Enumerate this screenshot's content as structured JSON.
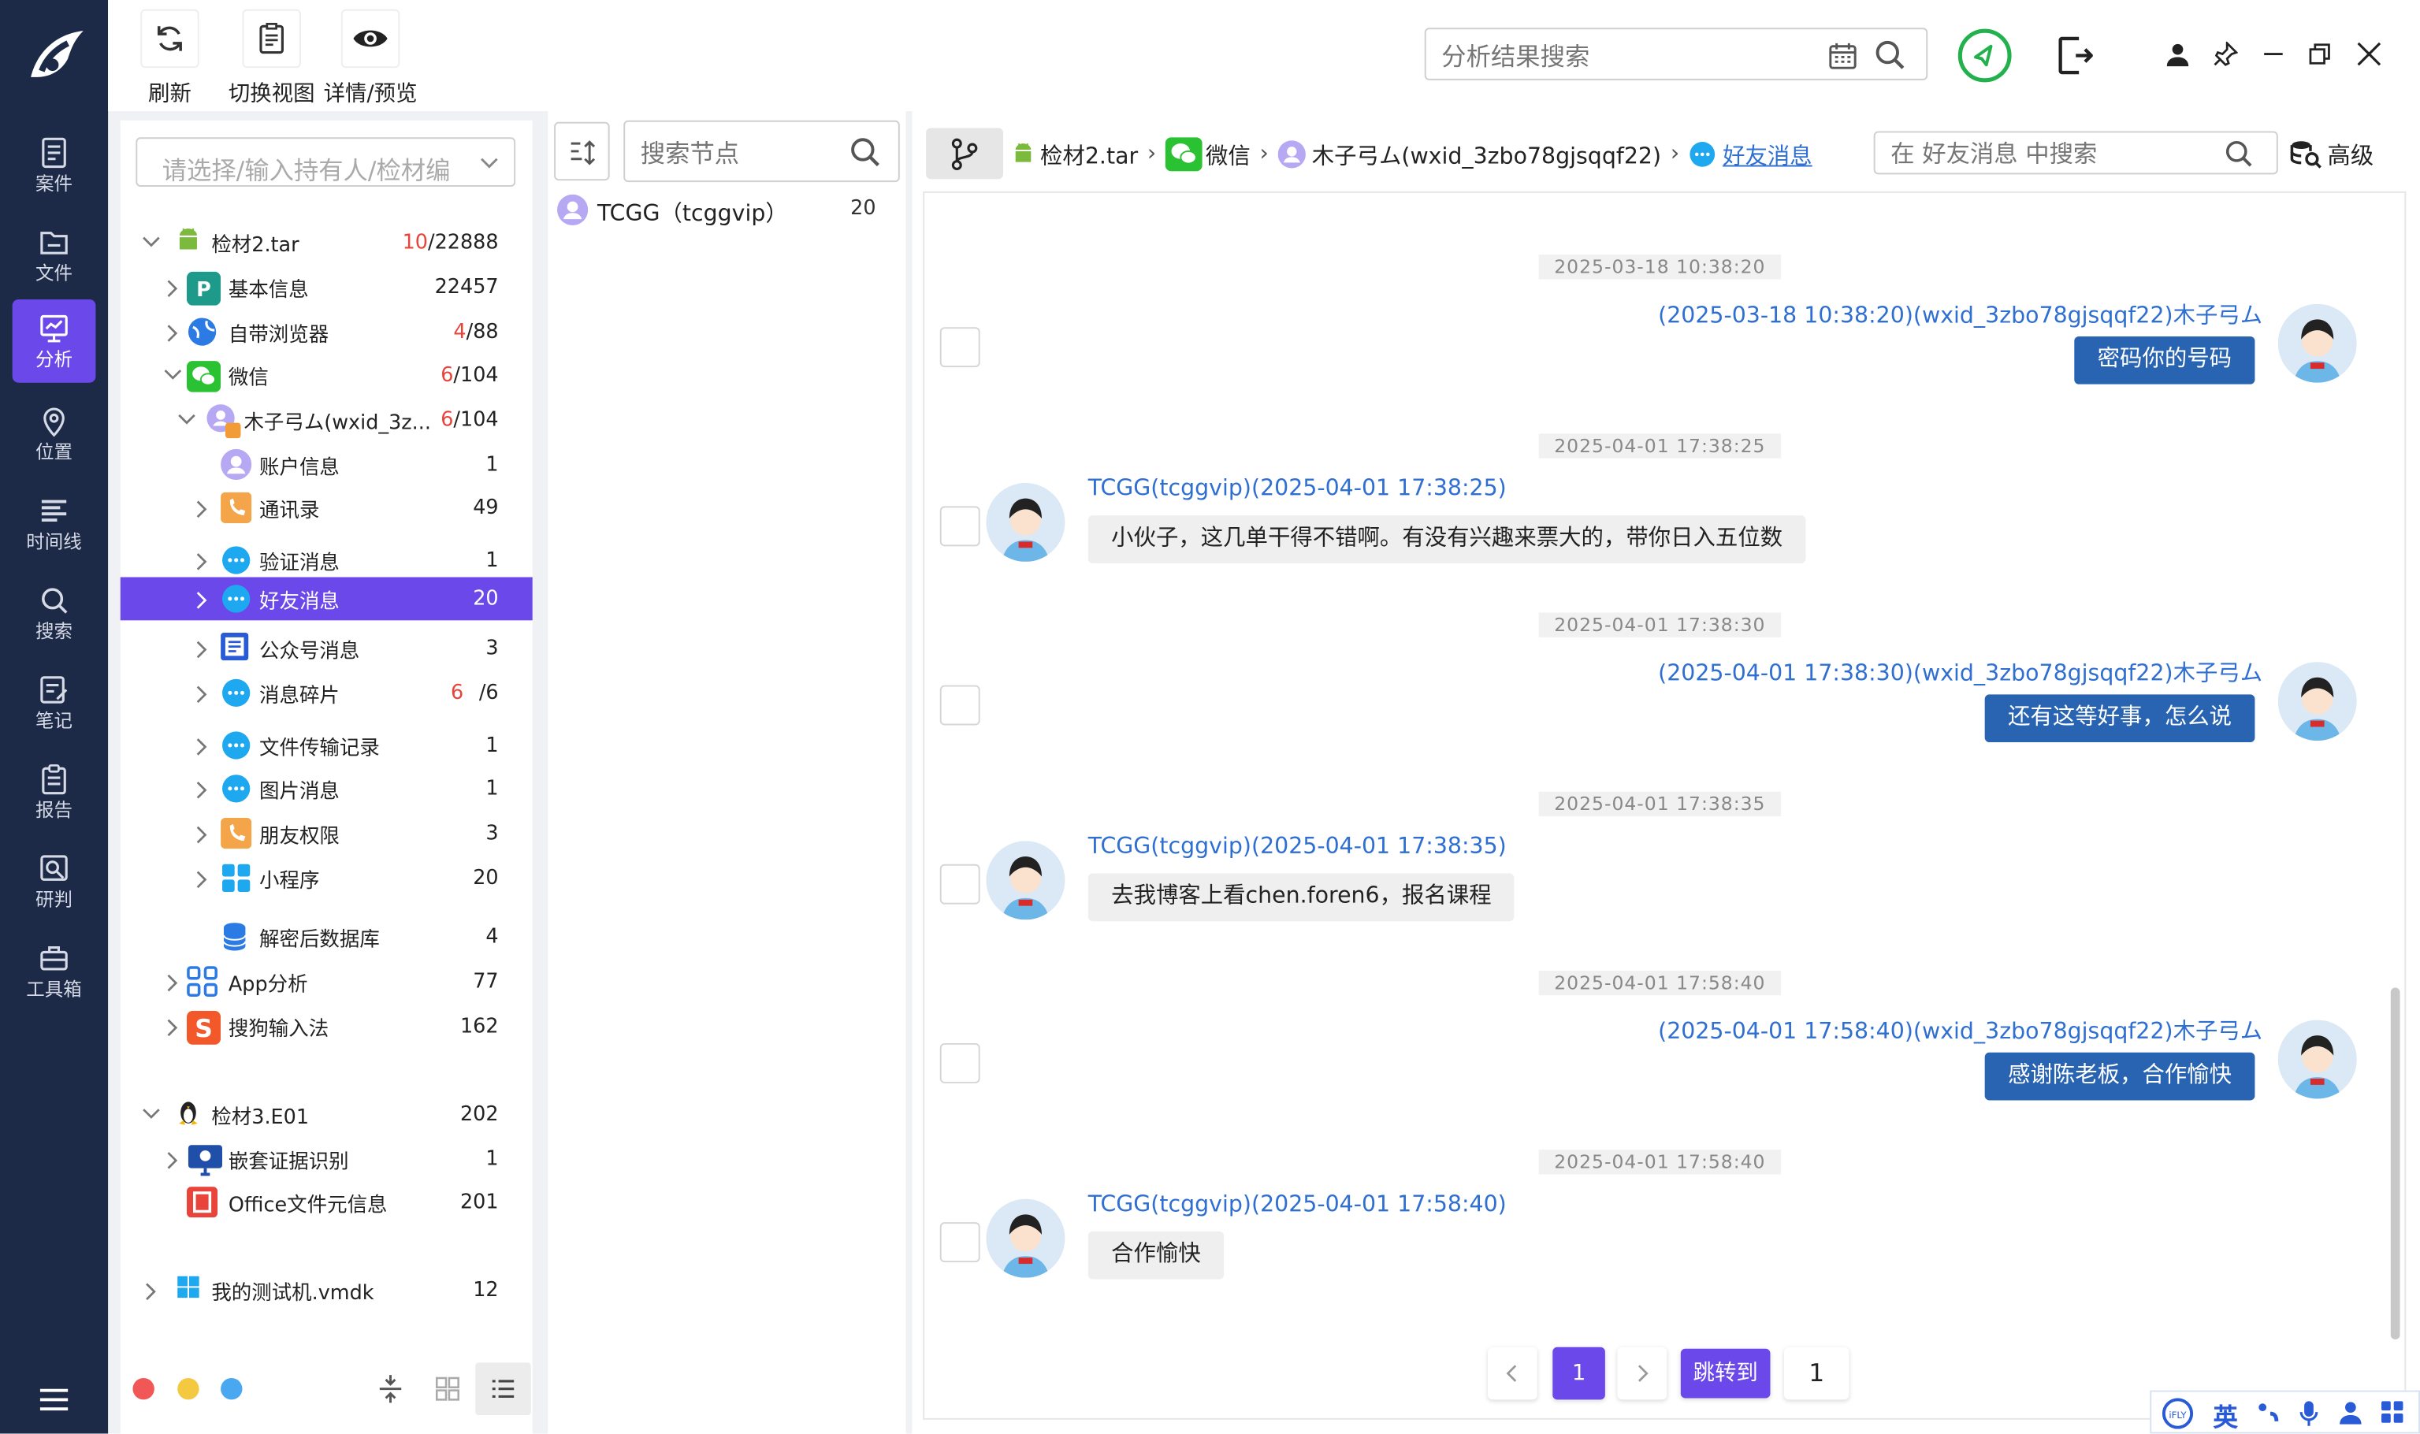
{
  "nav": {
    "items": [
      {
        "label": "案件"
      },
      {
        "label": "文件"
      },
      {
        "label": "分析"
      },
      {
        "label": "位置"
      },
      {
        "label": "时间线"
      },
      {
        "label": "搜索"
      },
      {
        "label": "笔记"
      },
      {
        "label": "报告"
      },
      {
        "label": "研判"
      },
      {
        "label": "工具箱"
      }
    ],
    "active": "分析"
  },
  "toolbar": {
    "refresh": "刷新",
    "switch_view": "切换视图",
    "detail_preview": "详情/预览",
    "search_placeholder": "分析结果搜索"
  },
  "tree": {
    "selector_placeholder": "请选择/输入持有人/检材编",
    "rows": [
      {
        "label": "检材2.tar",
        "count_hi": "10",
        "count": "/22888"
      },
      {
        "label": "基本信息",
        "count": "22457"
      },
      {
        "label": "自带浏览器",
        "count_hi": "4",
        "count": "/88"
      },
      {
        "label": "微信",
        "count_hi": "6",
        "count": "/104"
      },
      {
        "label": "木子弓ム(wxid_3z...",
        "count_hi": "6",
        "count": "/104"
      },
      {
        "label": "账户信息",
        "count": "1"
      },
      {
        "label": "通讯录",
        "count": "49"
      },
      {
        "label": "验证消息",
        "count": "1"
      },
      {
        "label": "好友消息",
        "count": "20"
      },
      {
        "label": "公众号消息",
        "count": "3"
      },
      {
        "label": "消息碎片",
        "count_hi": "6",
        "count": "/6"
      },
      {
        "label": "文件传输记录",
        "count": "1"
      },
      {
        "label": "图片消息",
        "count": "1"
      },
      {
        "label": "朋友权限",
        "count": "3"
      },
      {
        "label": "小程序",
        "count": "20"
      },
      {
        "label": "解密后数据库",
        "count": "4"
      },
      {
        "label": "App分析",
        "count": "77"
      },
      {
        "label": "搜狗输入法",
        "count": "162"
      },
      {
        "label": "检材3.E01",
        "count": "202"
      },
      {
        "label": "嵌套证据识别",
        "count": "1"
      },
      {
        "label": "Office文件元信息",
        "count": "201"
      },
      {
        "label": "我的测试机.vmdk",
        "count": "12"
      }
    ]
  },
  "nodes": {
    "search_placeholder": "搜索节点",
    "items": [
      {
        "label": "TCGG（tcggvip）",
        "count": "20"
      }
    ]
  },
  "breadcrumb": {
    "items": [
      "检材2.tar",
      "微信",
      "木子弓ム(wxid_3zbo78gjsqqf22)",
      "好友消息"
    ],
    "search_placeholder": "在 好友消息 中搜索",
    "advanced": "高级"
  },
  "messages": [
    {
      "time": "2025-03-18 10:38:20",
      "side": "right",
      "sender": "(2025-03-18 10:38:20)(wxid_3zbo78gjsqqf22)木子弓ム",
      "text": "密码你的号码"
    },
    {
      "time": "2025-04-01 17:38:25",
      "side": "left",
      "sender": "TCGG(tcggvip)(2025-04-01 17:38:25)",
      "text": "小伙子，这几单干得不错啊。有没有兴趣来票大的，带你日入五位数"
    },
    {
      "time": "2025-04-01 17:38:30",
      "side": "right",
      "sender": "(2025-04-01 17:38:30)(wxid_3zbo78gjsqqf22)木子弓ム",
      "text": "还有这等好事，怎么说"
    },
    {
      "time": "2025-04-01 17:38:35",
      "side": "left",
      "sender": "TCGG(tcggvip)(2025-04-01 17:38:35)",
      "text": "去我博客上看chen.foren6，报名课程"
    },
    {
      "time": "2025-04-01 17:58:40",
      "side": "right",
      "sender": "(2025-04-01 17:58:40)(wxid_3zbo78gjsqqf22)木子弓ム",
      "text": "感谢陈老板，合作愉快"
    },
    {
      "time": "2025-04-01 17:58:40",
      "side": "left",
      "sender": "TCGG(tcggvip)(2025-04-01 17:58:40)",
      "text": "合作愉快"
    }
  ],
  "pagination": {
    "current": "1",
    "jump_label": "跳转到",
    "jump_value": "1"
  },
  "ime": {
    "lang": "英"
  },
  "colors": {
    "accent": "#6b48ea",
    "nav_bg": "#1d2a47",
    "bubble_right": "#2964b2",
    "bubble_left": "#efefef",
    "sender_link": "#2f6fd1",
    "count_red": "#e8443b",
    "status_green": "#22b14c"
  },
  "status_dots": [
    "#f25757",
    "#f5c842",
    "#4aa8f0"
  ]
}
